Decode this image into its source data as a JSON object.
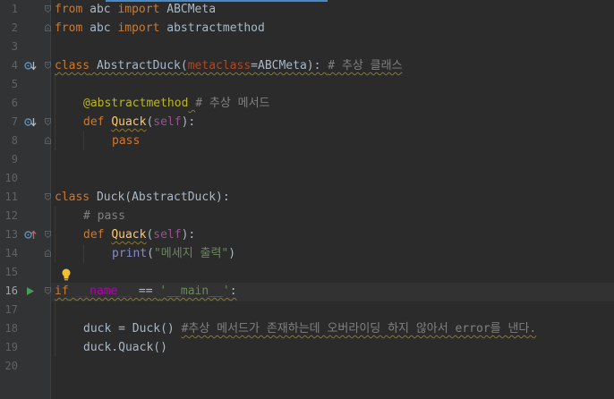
{
  "editor": {
    "current_line": 16,
    "lines": [
      {
        "n": 1,
        "text": "from abc import ABCMeta"
      },
      {
        "n": 2,
        "text": "from abc import abstractmethod"
      },
      {
        "n": 3,
        "text": ""
      },
      {
        "n": 4,
        "text": "class AbstractDuck(metaclass=ABCMeta): # 추상 클래스"
      },
      {
        "n": 5,
        "text": ""
      },
      {
        "n": 6,
        "text": "    @abstractmethod # 추상 메서드"
      },
      {
        "n": 7,
        "text": "    def Quack(self):"
      },
      {
        "n": 8,
        "text": "        pass"
      },
      {
        "n": 9,
        "text": ""
      },
      {
        "n": 10,
        "text": ""
      },
      {
        "n": 11,
        "text": "class Duck(AbstractDuck):"
      },
      {
        "n": 12,
        "text": "    # pass"
      },
      {
        "n": 13,
        "text": "    def Quack(self):"
      },
      {
        "n": 14,
        "text": "        print(\"메세지 출력\")"
      },
      {
        "n": 15,
        "text": ""
      },
      {
        "n": 16,
        "text": "if __name__ == '__main__':"
      },
      {
        "n": 17,
        "text": ""
      },
      {
        "n": 18,
        "text": "    duck = Duck() #추상 메서드가 존재하는데 오버라이딩 하지 않아서 error를 낸다."
      },
      {
        "n": 19,
        "text": "    duck.Quack()"
      },
      {
        "n": 20,
        "text": ""
      }
    ]
  },
  "tokens": {
    "l1": [
      "from",
      " abc ",
      "import",
      " ABCMeta"
    ],
    "l2": [
      "from",
      " abc ",
      "import",
      " abstractmethod"
    ],
    "l4": [
      "class",
      " AbstractDuck(",
      "metaclass",
      "=ABCMeta): ",
      "# 추상 클래스"
    ],
    "l6": [
      "@abstractmethod",
      " ",
      "# 추상 메서드"
    ],
    "l7": [
      "def",
      " ",
      "Quack",
      "(",
      "self",
      "):"
    ],
    "l8": [
      "pass"
    ],
    "l11": [
      "class",
      " Duck(AbstractDuck):"
    ],
    "l12": [
      "# pass"
    ],
    "l13": [
      "def",
      " ",
      "Quack",
      "(",
      "self",
      "):"
    ],
    "l14": [
      "print",
      "(",
      "\"메세지 출력\"",
      ")"
    ],
    "l16": [
      "if",
      " ",
      "__name__",
      " == ",
      "'__main__'",
      ":"
    ],
    "l18": [
      "duck = Duck() ",
      "#추상 메서드가 존재하는데 오버라이딩 하지 않아서 error를 낸다."
    ],
    "l19": [
      "duck.Quack()"
    ]
  },
  "gutter_icons": {
    "l4": "implemented-override-icon",
    "l7": "implemented-override-icon",
    "l13": "overrides-icon",
    "l16": "run-icon"
  },
  "colors": {
    "background": "#2b2b2b",
    "keyword": "#cc7832",
    "function": "#ffc66d",
    "comment": "#808080",
    "string": "#6a8759"
  }
}
